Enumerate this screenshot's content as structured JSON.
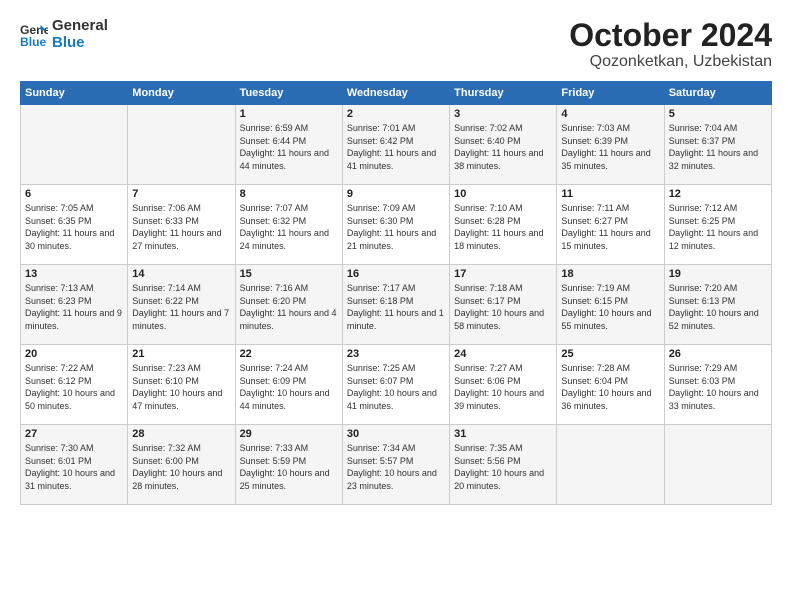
{
  "header": {
    "logo_line1": "General",
    "logo_line2": "Blue",
    "month": "October 2024",
    "location": "Qozonketkan, Uzbekistan"
  },
  "weekdays": [
    "Sunday",
    "Monday",
    "Tuesday",
    "Wednesday",
    "Thursday",
    "Friday",
    "Saturday"
  ],
  "weeks": [
    [
      {
        "day": "",
        "info": ""
      },
      {
        "day": "",
        "info": ""
      },
      {
        "day": "1",
        "info": "Sunrise: 6:59 AM\nSunset: 6:44 PM\nDaylight: 11 hours and 44 minutes."
      },
      {
        "day": "2",
        "info": "Sunrise: 7:01 AM\nSunset: 6:42 PM\nDaylight: 11 hours and 41 minutes."
      },
      {
        "day": "3",
        "info": "Sunrise: 7:02 AM\nSunset: 6:40 PM\nDaylight: 11 hours and 38 minutes."
      },
      {
        "day": "4",
        "info": "Sunrise: 7:03 AM\nSunset: 6:39 PM\nDaylight: 11 hours and 35 minutes."
      },
      {
        "day": "5",
        "info": "Sunrise: 7:04 AM\nSunset: 6:37 PM\nDaylight: 11 hours and 32 minutes."
      }
    ],
    [
      {
        "day": "6",
        "info": "Sunrise: 7:05 AM\nSunset: 6:35 PM\nDaylight: 11 hours and 30 minutes."
      },
      {
        "day": "7",
        "info": "Sunrise: 7:06 AM\nSunset: 6:33 PM\nDaylight: 11 hours and 27 minutes."
      },
      {
        "day": "8",
        "info": "Sunrise: 7:07 AM\nSunset: 6:32 PM\nDaylight: 11 hours and 24 minutes."
      },
      {
        "day": "9",
        "info": "Sunrise: 7:09 AM\nSunset: 6:30 PM\nDaylight: 11 hours and 21 minutes."
      },
      {
        "day": "10",
        "info": "Sunrise: 7:10 AM\nSunset: 6:28 PM\nDaylight: 11 hours and 18 minutes."
      },
      {
        "day": "11",
        "info": "Sunrise: 7:11 AM\nSunset: 6:27 PM\nDaylight: 11 hours and 15 minutes."
      },
      {
        "day": "12",
        "info": "Sunrise: 7:12 AM\nSunset: 6:25 PM\nDaylight: 11 hours and 12 minutes."
      }
    ],
    [
      {
        "day": "13",
        "info": "Sunrise: 7:13 AM\nSunset: 6:23 PM\nDaylight: 11 hours and 9 minutes."
      },
      {
        "day": "14",
        "info": "Sunrise: 7:14 AM\nSunset: 6:22 PM\nDaylight: 11 hours and 7 minutes."
      },
      {
        "day": "15",
        "info": "Sunrise: 7:16 AM\nSunset: 6:20 PM\nDaylight: 11 hours and 4 minutes."
      },
      {
        "day": "16",
        "info": "Sunrise: 7:17 AM\nSunset: 6:18 PM\nDaylight: 11 hours and 1 minute."
      },
      {
        "day": "17",
        "info": "Sunrise: 7:18 AM\nSunset: 6:17 PM\nDaylight: 10 hours and 58 minutes."
      },
      {
        "day": "18",
        "info": "Sunrise: 7:19 AM\nSunset: 6:15 PM\nDaylight: 10 hours and 55 minutes."
      },
      {
        "day": "19",
        "info": "Sunrise: 7:20 AM\nSunset: 6:13 PM\nDaylight: 10 hours and 52 minutes."
      }
    ],
    [
      {
        "day": "20",
        "info": "Sunrise: 7:22 AM\nSunset: 6:12 PM\nDaylight: 10 hours and 50 minutes."
      },
      {
        "day": "21",
        "info": "Sunrise: 7:23 AM\nSunset: 6:10 PM\nDaylight: 10 hours and 47 minutes."
      },
      {
        "day": "22",
        "info": "Sunrise: 7:24 AM\nSunset: 6:09 PM\nDaylight: 10 hours and 44 minutes."
      },
      {
        "day": "23",
        "info": "Sunrise: 7:25 AM\nSunset: 6:07 PM\nDaylight: 10 hours and 41 minutes."
      },
      {
        "day": "24",
        "info": "Sunrise: 7:27 AM\nSunset: 6:06 PM\nDaylight: 10 hours and 39 minutes."
      },
      {
        "day": "25",
        "info": "Sunrise: 7:28 AM\nSunset: 6:04 PM\nDaylight: 10 hours and 36 minutes."
      },
      {
        "day": "26",
        "info": "Sunrise: 7:29 AM\nSunset: 6:03 PM\nDaylight: 10 hours and 33 minutes."
      }
    ],
    [
      {
        "day": "27",
        "info": "Sunrise: 7:30 AM\nSunset: 6:01 PM\nDaylight: 10 hours and 31 minutes."
      },
      {
        "day": "28",
        "info": "Sunrise: 7:32 AM\nSunset: 6:00 PM\nDaylight: 10 hours and 28 minutes."
      },
      {
        "day": "29",
        "info": "Sunrise: 7:33 AM\nSunset: 5:59 PM\nDaylight: 10 hours and 25 minutes."
      },
      {
        "day": "30",
        "info": "Sunrise: 7:34 AM\nSunset: 5:57 PM\nDaylight: 10 hours and 23 minutes."
      },
      {
        "day": "31",
        "info": "Sunrise: 7:35 AM\nSunset: 5:56 PM\nDaylight: 10 hours and 20 minutes."
      },
      {
        "day": "",
        "info": ""
      },
      {
        "day": "",
        "info": ""
      }
    ]
  ]
}
